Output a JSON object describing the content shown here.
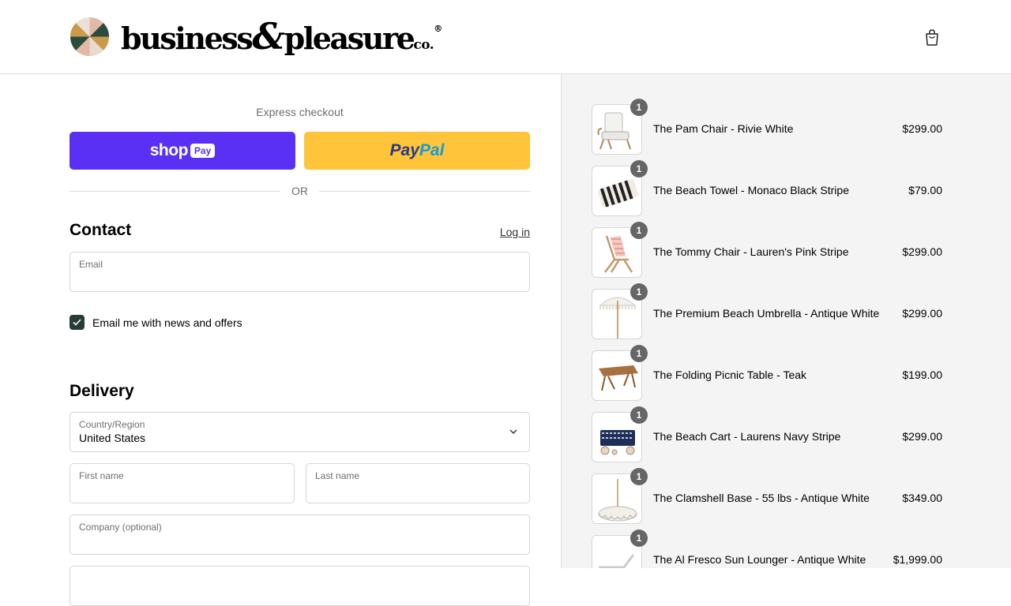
{
  "header": {
    "brand_main": "business",
    "brand_amp": "&",
    "brand_second": "pleasure",
    "brand_co": "co.",
    "brand_reg": "®",
    "cart_icon": "shopping-bag-icon"
  },
  "express": {
    "title": "Express checkout",
    "shop_word": "shop",
    "shop_badge": "Pay",
    "paypal_pay": "Pay",
    "paypal_pal": "Pal",
    "or": "OR"
  },
  "contact": {
    "heading": "Contact",
    "login": "Log in",
    "email_label": "Email",
    "email_value": "",
    "newsletter_label": "Email me with news and offers",
    "newsletter_checked": true
  },
  "delivery": {
    "heading": "Delivery",
    "country_label": "Country/Region",
    "country_value": "United States",
    "first_name_label": "First name",
    "last_name_label": "Last name",
    "company_label": "Company (optional)"
  },
  "colors": {
    "shop_pay": "#5a31f4",
    "paypal": "#ffc439",
    "checkbox": "#263c39",
    "summary_bg": "#f4f4f4"
  },
  "cart": {
    "items": [
      {
        "qty": "1",
        "name": "The Pam Chair - Rivie White",
        "price": "$299.00"
      },
      {
        "qty": "1",
        "name": "The Beach Towel - Monaco Black Stripe",
        "price": "$79.00"
      },
      {
        "qty": "1",
        "name": "The Tommy Chair - Lauren's Pink Stripe",
        "price": "$299.00"
      },
      {
        "qty": "1",
        "name": "The Premium Beach Umbrella - Antique White",
        "price": "$299.00"
      },
      {
        "qty": "1",
        "name": "The Folding Picnic Table - Teak",
        "price": "$199.00"
      },
      {
        "qty": "1",
        "name": "The Beach Cart - Laurens Navy Stripe",
        "price": "$299.00"
      },
      {
        "qty": "1",
        "name": "The Clamshell Base - 55 lbs - Antique White",
        "price": "$349.00"
      },
      {
        "qty": "1",
        "name": "The Al Fresco Sun Lounger - Antique White",
        "price": "$1,999.00"
      }
    ]
  }
}
